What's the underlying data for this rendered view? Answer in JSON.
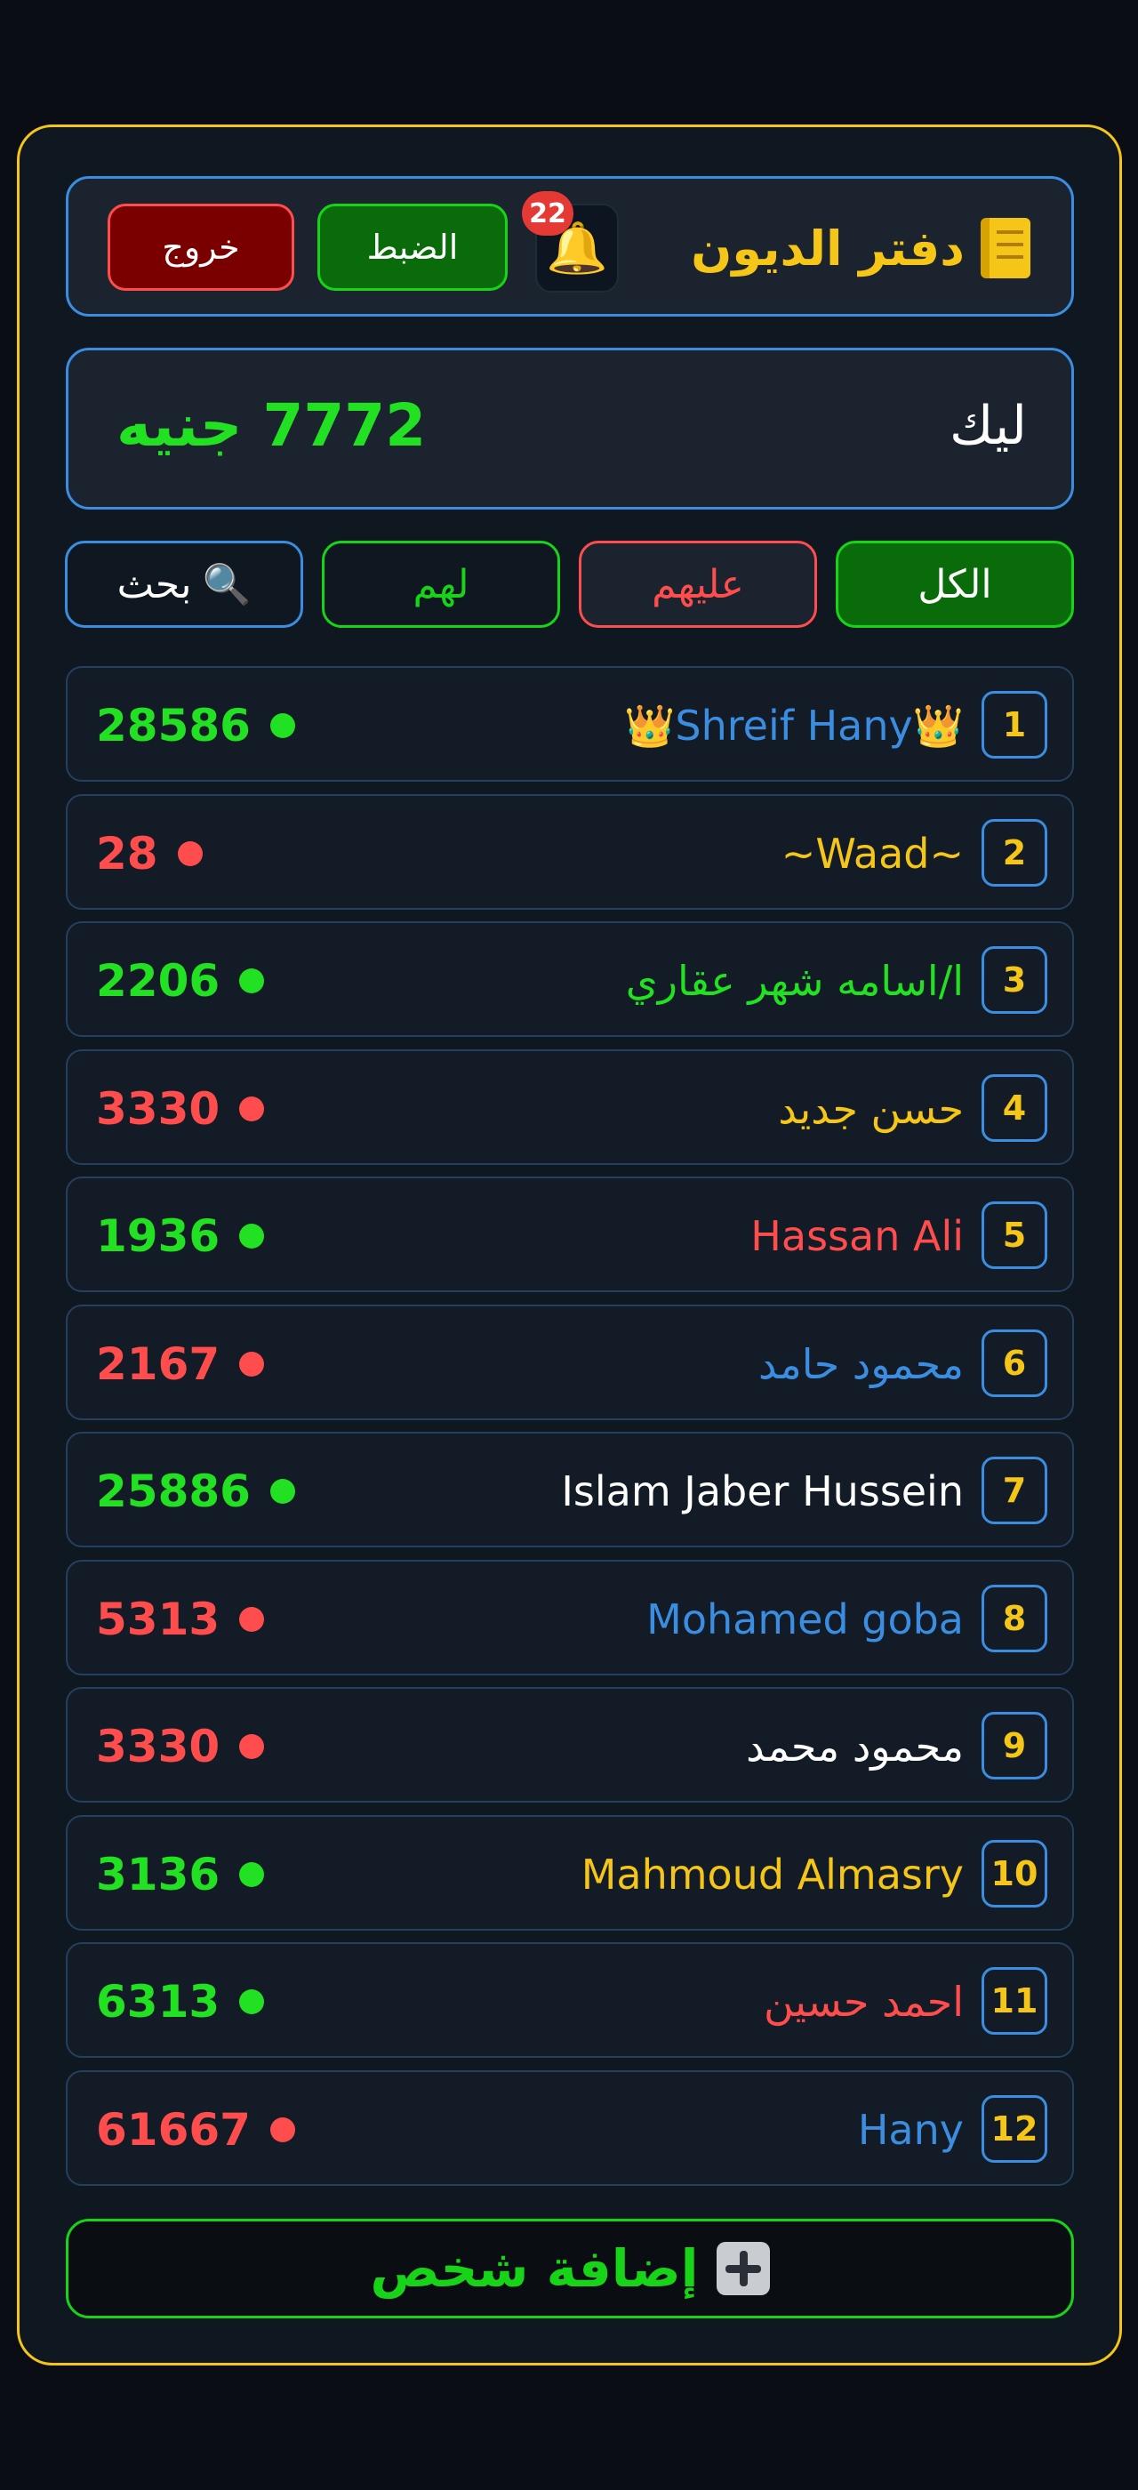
{
  "header": {
    "title": "دفتر الديون",
    "title_icon": "notebook-icon",
    "bell_icon": "bell-icon",
    "notification_count": "22",
    "settings_label": "الضبط",
    "logout_label": "خروج"
  },
  "balance": {
    "label": "ليك",
    "amount": "7772 جنيه"
  },
  "filters": {
    "all": "الكل",
    "owe": "عليهم",
    "owed": "لهم",
    "search": "بحث",
    "search_icon": "magnifier-icon"
  },
  "people": [
    {
      "num": "1",
      "name": "👑Shreif Hany👑",
      "amount": "28586",
      "name_color": "#3a8de0",
      "status": "positive"
    },
    {
      "num": "2",
      "name": "~Waad~",
      "amount": "28",
      "name_color": "#f5c518",
      "status": "negative"
    },
    {
      "num": "3",
      "name": "ا/اسامه شهر عقاري",
      "amount": "2206",
      "name_color": "#22e022",
      "status": "positive"
    },
    {
      "num": "4",
      "name": "حسن جديد",
      "amount": "3330",
      "name_color": "#f5c518",
      "status": "negative"
    },
    {
      "num": "5",
      "name": "Hassan Ali",
      "amount": "1936",
      "name_color": "#ff4d4d",
      "status": "positive"
    },
    {
      "num": "6",
      "name": "محمود حامد",
      "amount": "2167",
      "name_color": "#3a8de0",
      "status": "negative"
    },
    {
      "num": "7",
      "name": "Islam Jaber Hussein",
      "amount": "25886",
      "name_color": "#ffffff",
      "status": "positive"
    },
    {
      "num": "8",
      "name": "Mohamed goba",
      "amount": "5313",
      "name_color": "#3a8de0",
      "status": "negative"
    },
    {
      "num": "9",
      "name": "محمود محمد",
      "amount": "3330",
      "name_color": "#ffffff",
      "status": "negative"
    },
    {
      "num": "10",
      "name": "Mahmoud Almasry",
      "amount": "3136",
      "name_color": "#f5c518",
      "status": "positive"
    },
    {
      "num": "11",
      "name": "احمد حسين",
      "amount": "6313",
      "name_color": "#ff4d4d",
      "status": "positive"
    },
    {
      "num": "12",
      "name": "Hany",
      "amount": "61667",
      "name_color": "#3a8de0",
      "status": "negative"
    }
  ],
  "add_button": {
    "label": "إضافة شخص",
    "icon": "plus-icon"
  },
  "colors": {
    "positive": "#22e022",
    "negative": "#ff4d4d",
    "accent": "#f5c518",
    "border_blue": "#3a8de0"
  }
}
